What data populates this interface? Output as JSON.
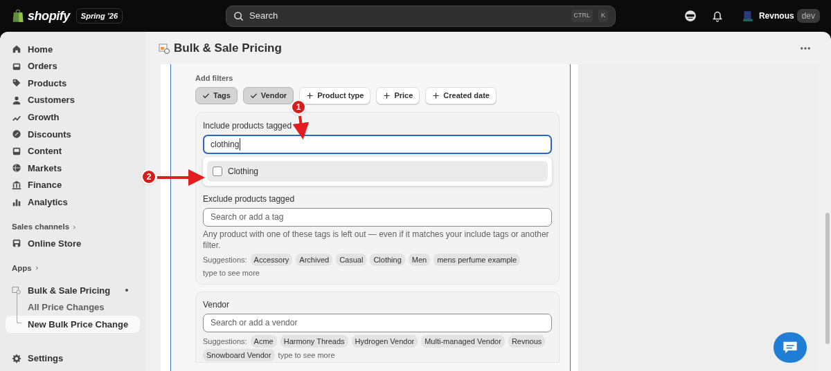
{
  "topbar": {
    "logo_text": "shopify",
    "release_badge": "Spring ’26",
    "search": {
      "placeholder": "Search",
      "shortcut_keys": [
        "CTRL",
        "K"
      ]
    },
    "user": {
      "name": "Revnous",
      "badge": "dev"
    }
  },
  "sidebar": {
    "items": [
      {
        "label": "Home",
        "selected": false
      },
      {
        "label": "Orders",
        "selected": false
      },
      {
        "label": "Products",
        "selected": false
      },
      {
        "label": "Customers",
        "selected": false
      },
      {
        "label": "Growth",
        "selected": false
      },
      {
        "label": "Discounts",
        "selected": false
      },
      {
        "label": "Content",
        "selected": false
      },
      {
        "label": "Markets",
        "selected": false
      },
      {
        "label": "Finance",
        "selected": false
      },
      {
        "label": "Analytics",
        "selected": false
      }
    ],
    "sections": [
      {
        "title": "Sales channels",
        "items": [
          {
            "label": "Online Store",
            "selected": false
          }
        ]
      },
      {
        "title": "Apps",
        "items": [
          {
            "label": "Bulk & Sale Pricing",
            "selected": false,
            "children": [
              {
                "label": "All Price Changes",
                "selected": false
              },
              {
                "label": "New Bulk Price Change",
                "selected": true
              }
            ]
          }
        ]
      }
    ],
    "footer_item": {
      "label": "Settings",
      "selected": false
    }
  },
  "page": {
    "title": "Bulk & Sale Pricing"
  },
  "filters": {
    "label": "Add filters",
    "chips": [
      {
        "label": "Tags",
        "selected": true
      },
      {
        "label": "Vendor",
        "selected": true
      },
      {
        "label": "Product type",
        "selected": false
      },
      {
        "label": "Price",
        "selected": false
      },
      {
        "label": "Created date",
        "selected": false
      }
    ]
  },
  "tags_panel": {
    "include": {
      "label": "Include products tagged",
      "value": "clothing",
      "focused": true,
      "options": [
        {
          "label": "Clothing",
          "checked": false,
          "highlighted": true
        }
      ]
    },
    "exclude": {
      "label": "Exclude products tagged",
      "placeholder": "Search or add a tag",
      "help": "Any product with one of these tags is left out — even if it matches your include tags or another filter.",
      "suggestions_label": "Suggestions:",
      "suggestions": [
        "Accessory",
        "Archived",
        "Casual",
        "Clothing",
        "Men",
        "mens perfume example"
      ],
      "more": "type to see more"
    }
  },
  "vendor_panel": {
    "label": "Vendor",
    "placeholder": "Search or add a vendor",
    "suggestions_label": "Suggestions:",
    "suggestions": [
      "Acme",
      "Harmony Threads",
      "Hydrogen Vendor",
      "Multi-managed Vendor",
      "Revnous",
      "Snowboard Vendor"
    ],
    "more": "type to see more"
  },
  "annotations": [
    {
      "number": "1"
    },
    {
      "number": "2"
    }
  ]
}
